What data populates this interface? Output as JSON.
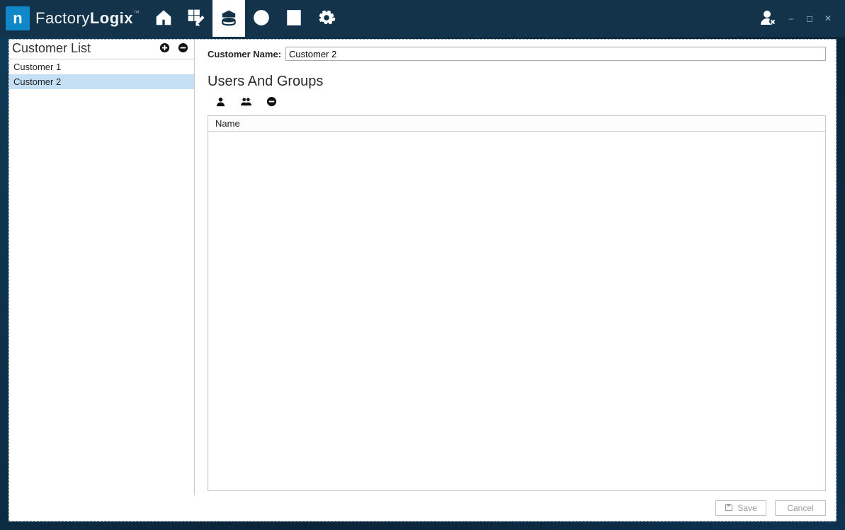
{
  "brand": {
    "logo_text": "n",
    "name_prefix": "Factory",
    "name_suffix": "Logix",
    "trademark": "™"
  },
  "toolbar": {
    "items": [
      {
        "icon": "home"
      },
      {
        "icon": "grid-edit"
      },
      {
        "icon": "box-db",
        "active": true
      },
      {
        "icon": "globe-arrows"
      },
      {
        "icon": "document"
      },
      {
        "icon": "gear"
      }
    ]
  },
  "window_controls": {
    "minimize": "–",
    "maximize": "◻",
    "close": "✕"
  },
  "sidebar": {
    "title": "Customer List",
    "items": [
      {
        "label": "Customer 1",
        "selected": false
      },
      {
        "label": "Customer 2",
        "selected": true
      }
    ]
  },
  "detail": {
    "customer_name_label": "Customer Name:",
    "customer_name_value": "Customer 2",
    "users_groups_title": "Users And Groups",
    "grid": {
      "columns": [
        "Name"
      ],
      "rows": []
    }
  },
  "footer": {
    "save_label": "Save",
    "cancel_label": "Cancel"
  }
}
